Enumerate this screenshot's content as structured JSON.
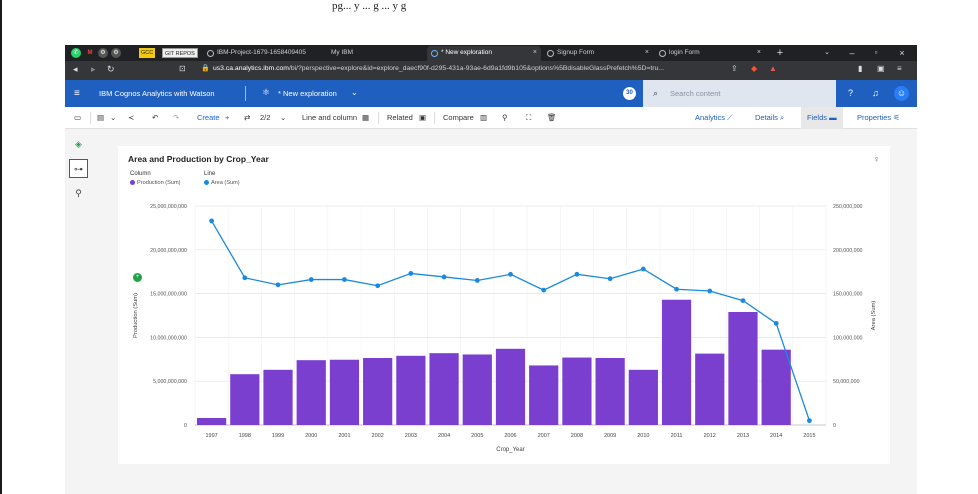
{
  "top_text": "pg... y ... g ... y g",
  "browser": {
    "tabs": [
      {
        "label": "IBM-Project-1679-1658409405"
      },
      {
        "label": "My IBM"
      },
      {
        "label": "* New exploration"
      },
      {
        "label": "Signup Form"
      },
      {
        "label": "login Form"
      }
    ],
    "ext_gcc": "GCC",
    "ext_git": "GIT REPOS",
    "url_domain": "us3.ca.analytics.ibm.com",
    "url_rest": "/bi/?perspective=explore&id=explore_daecf90f-d295-431a-93ae-6d9a1fd9b105&options%5BdisableGlassPrefetch%5D=tru..."
  },
  "app": {
    "brand": "IBM Cognos Analytics with Watson",
    "exploration": "* New exploration",
    "badge": "30",
    "search_placeholder": "Search content"
  },
  "toolbar": {
    "create": "Create",
    "page": "2/2",
    "chart_type": "Line and column",
    "related": "Related",
    "compare": "Compare",
    "analytics": "Analytics",
    "details": "Details",
    "fields": "Fields",
    "properties": "Properties"
  },
  "card": {
    "title": "Area and Production by Crop_Year",
    "legend": {
      "column_header": "Column",
      "line_header": "Line",
      "column_item": "Production (Sum)",
      "line_item": "Area (Sum)"
    }
  },
  "colors": {
    "bar": "#7b3fcf",
    "line": "#1a8ae0",
    "brand": "#1f5fbf"
  },
  "chart_data": {
    "type": "bar",
    "title": "Area and Production by Crop_Year",
    "xlabel": "Crop_Year",
    "ylabel": "Production (Sum)",
    "y2label": "Area (Sum)",
    "categories": [
      "1997",
      "1998",
      "1999",
      "2000",
      "2001",
      "2002",
      "2003",
      "2004",
      "2005",
      "2006",
      "2007",
      "2008",
      "2009",
      "2010",
      "2011",
      "2012",
      "2013",
      "2014",
      "2015"
    ],
    "series": [
      {
        "name": "Production (Sum)",
        "type": "bar",
        "axis": "left",
        "values": [
          800000000,
          5800000000,
          6300000000,
          7400000000,
          7450000000,
          7650000000,
          7900000000,
          8200000000,
          8050000000,
          8700000000,
          6800000000,
          7700000000,
          7650000000,
          6300000000,
          14300000000,
          8150000000,
          12900000000,
          8600000000,
          null
        ]
      },
      {
        "name": "Area (Sum)",
        "type": "line",
        "axis": "right",
        "values": [
          233000000,
          168000000,
          160000000,
          166000000,
          166000000,
          159000000,
          173000000,
          169000000,
          165000000,
          172000000,
          154000000,
          172000000,
          167000000,
          178000000,
          155000000,
          153000000,
          142000000,
          116000000,
          5000000
        ]
      }
    ],
    "ylim": [
      0,
      25000000000
    ],
    "y2lim": [
      0,
      250000000
    ],
    "yticks": [
      "0",
      "5,000,000,000",
      "10,000,000,000",
      "15,000,000,000",
      "20,000,000,000",
      "25,000,000,000"
    ],
    "y2ticks": [
      "0",
      "50,000,000",
      "100,000,000",
      "150,000,000",
      "200,000,000",
      "250,000,000"
    ],
    "grid": true,
    "legend_position": "top-left"
  }
}
